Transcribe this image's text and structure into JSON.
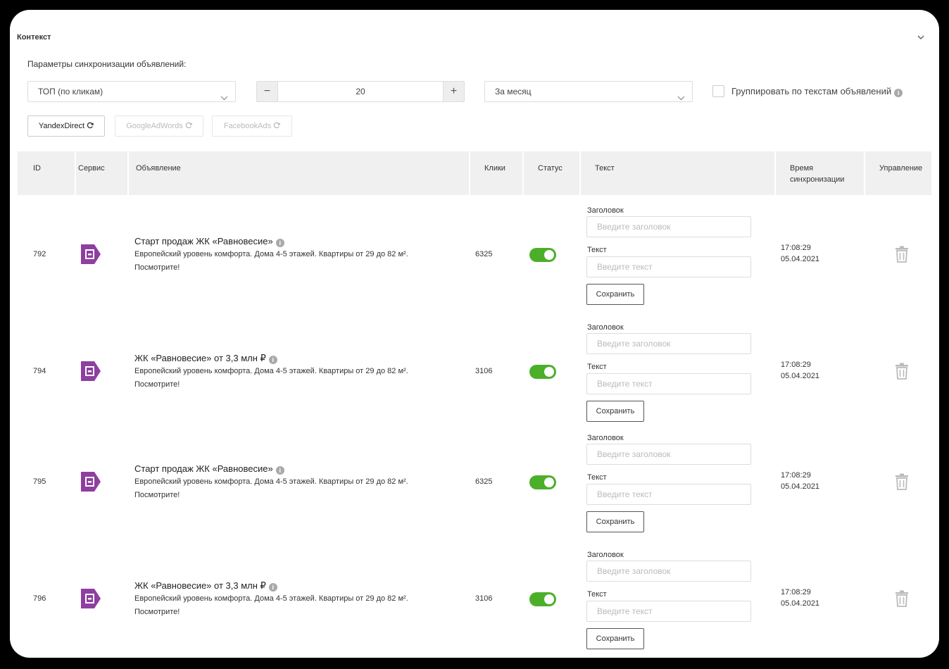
{
  "panel": {
    "title": "Контекст"
  },
  "sync": {
    "label": "Параметры синхронизации объявлений:",
    "top_select": "ТОП (по кликам)",
    "count": "20",
    "period_select": "За месяц",
    "group_label": "Группировать по текстам объявлений"
  },
  "services": [
    {
      "label": "YandexDirect",
      "active": true
    },
    {
      "label": "GoogleAdWords",
      "active": false
    },
    {
      "label": "FacebookAds",
      "active": false
    }
  ],
  "table": {
    "headers": {
      "id": "ID",
      "service": "Сервис",
      "ad": "Объявление",
      "clicks": "Клики",
      "status": "Статус",
      "text": "Текст",
      "sync_time_1": "Время",
      "sync_time_2": "синхронизации",
      "manage": "Управление"
    },
    "form": {
      "title_label": "Заголовок",
      "title_placeholder": "Введите заголовок",
      "text_label": "Текст",
      "text_placeholder": "Введите текст",
      "save_label": "Сохранить"
    },
    "rows": [
      {
        "id": "792",
        "title": "Старт продаж ЖК «Равновесие»",
        "desc": "Европейский уровень комфорта. Дома 4-5 этажей. Квартиры от 29 до 82 м².",
        "desc2": "Посмотрите!",
        "clicks": "6325",
        "enabled": true,
        "time": "17:08:29",
        "date": "05.04.2021"
      },
      {
        "id": "794",
        "title": "ЖК «Равновесие» от 3,3 млн ₽",
        "desc": "Европейский уровень комфорта. Дома 4-5 этажей. Квартиры от 29 до 82 м².",
        "desc2": "Посмотрите!",
        "clicks": "3106",
        "enabled": true,
        "time": "17:08:29",
        "date": "05.04.2021"
      },
      {
        "id": "795",
        "title": "Старт продаж ЖК «Равновесие»",
        "desc": "Европейский уровень комфорта. Дома 4-5 этажей. Квартиры от 29 до 82 м².",
        "desc2": "Посмотрите!",
        "clicks": "6325",
        "enabled": true,
        "time": "17:08:29",
        "date": "05.04.2021"
      },
      {
        "id": "796",
        "title": "ЖК «Равновесие» от 3,3 млн ₽",
        "desc": "Европейский уровень комфорта. Дома 4-5 этажей. Квартиры от 29 до 82 м².",
        "desc2": "Посмотрите!",
        "clicks": "3106",
        "enabled": true,
        "time": "17:08:29",
        "date": "05.04.2021"
      }
    ]
  },
  "colors": {
    "toggle_on": "#4caf2a",
    "service_icon": "#8e3fa0",
    "header_bg": "#f0f0f0"
  }
}
